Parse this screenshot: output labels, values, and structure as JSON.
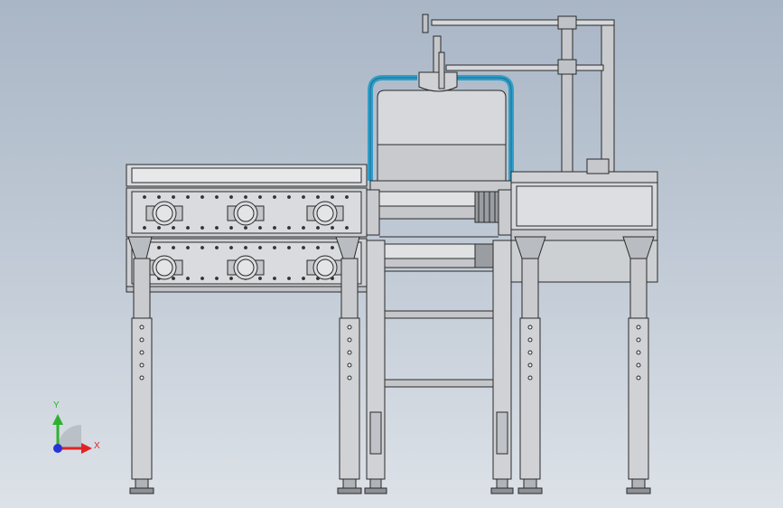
{
  "viewport": {
    "background_top": "#a9b6c6",
    "background_bottom": "#dde2e8"
  },
  "model": {
    "line_color": "#2a2a2a",
    "steel_fill": "#cfd1d4",
    "steel_dark": "#a9acb0",
    "panel_fill": "#d8dadd",
    "pipe_color": "#2f9ec9",
    "roller_count_left_upper": 3,
    "roller_count_left_lower": 3
  },
  "triad": {
    "x_label": "X",
    "y_label": "Y",
    "x_color": "#e02424",
    "y_color": "#2fb12f",
    "z_color": "#2434d6"
  }
}
